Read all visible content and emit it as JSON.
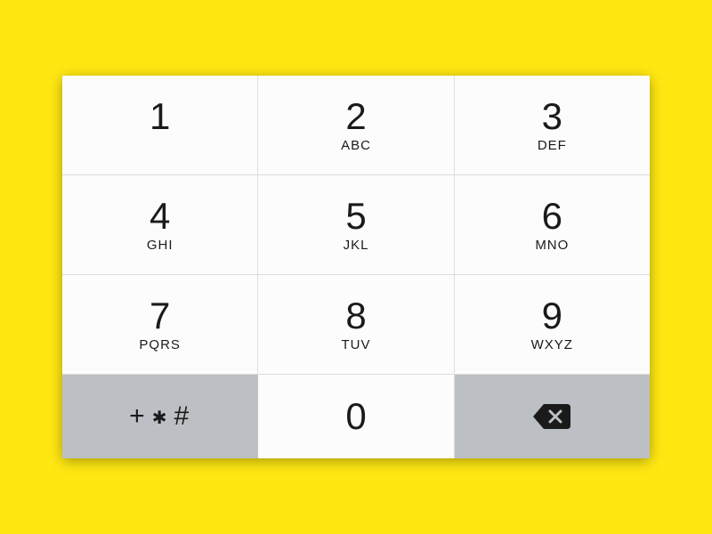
{
  "keypad": {
    "keys": [
      {
        "number": "1",
        "letters": ""
      },
      {
        "number": "2",
        "letters": "ABC"
      },
      {
        "number": "3",
        "letters": "DEF"
      },
      {
        "number": "4",
        "letters": "GHI"
      },
      {
        "number": "5",
        "letters": "JKL"
      },
      {
        "number": "6",
        "letters": "MNO"
      },
      {
        "number": "7",
        "letters": "PQRS"
      },
      {
        "number": "8",
        "letters": "TUV"
      },
      {
        "number": "9",
        "letters": "WXYZ"
      }
    ],
    "symbols": {
      "plus": "+",
      "star": "✱",
      "hash": "#"
    },
    "zero": "0",
    "backspace_icon": "backspace"
  }
}
